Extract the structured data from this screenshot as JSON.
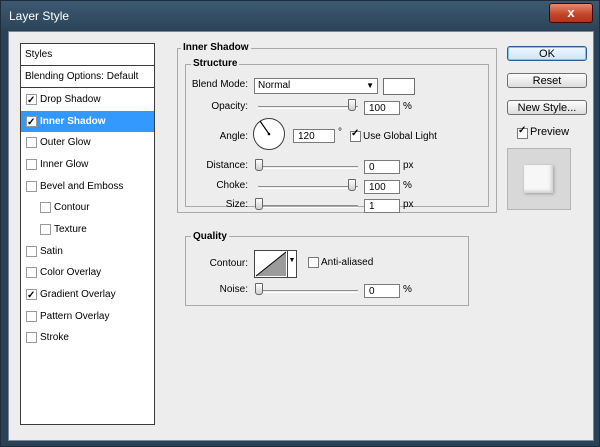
{
  "window": {
    "title": "Layer Style",
    "close": "x"
  },
  "list": {
    "header": "Styles",
    "items": [
      {
        "label": "Blending Options: Default",
        "checkbox": false
      },
      {
        "label": "Drop Shadow",
        "checkbox": true,
        "checked": true
      },
      {
        "label": "Inner Shadow",
        "checkbox": true,
        "checked": true,
        "selected": true
      },
      {
        "label": "Outer Glow",
        "checkbox": true,
        "checked": false
      },
      {
        "label": "Inner Glow",
        "checkbox": true,
        "checked": false
      },
      {
        "label": "Bevel and Emboss",
        "checkbox": true,
        "checked": false
      },
      {
        "label": "Contour",
        "checkbox": true,
        "checked": false
      },
      {
        "label": "Texture",
        "checkbox": true,
        "checked": false
      },
      {
        "label": "Satin",
        "checkbox": true,
        "checked": false
      },
      {
        "label": "Color Overlay",
        "checkbox": true,
        "checked": false
      },
      {
        "label": "Gradient Overlay",
        "checkbox": true,
        "checked": true
      },
      {
        "label": "Pattern Overlay",
        "checkbox": true,
        "checked": false
      },
      {
        "label": "Stroke",
        "checkbox": true,
        "checked": false
      }
    ]
  },
  "panel": {
    "title": "Inner Shadow",
    "structure": {
      "title": "Structure",
      "blend_mode_label": "Blend Mode:",
      "blend_mode_value": "Normal",
      "opacity_label": "Opacity:",
      "opacity_value": "100",
      "opacity_unit": "%",
      "opacity_level": 1.0,
      "angle_label": "Angle:",
      "angle_value": "120",
      "angle_unit": "°",
      "use_global_light": "Use Global Light",
      "distance_label": "Distance:",
      "distance_value": "0",
      "distance_unit": "px",
      "distance_level": 0.0,
      "choke_label": "Choke:",
      "choke_value": "100",
      "choke_unit": "%",
      "choke_level": 1.0,
      "size_label": "Size:",
      "size_value": "1",
      "size_unit": "px",
      "size_level": 0.0
    },
    "quality": {
      "title": "Quality",
      "contour_label": "Contour:",
      "anti_aliased": "Anti-aliased",
      "noise_label": "Noise:",
      "noise_value": "0",
      "noise_unit": "%",
      "noise_level": 0.0
    }
  },
  "buttons": {
    "ok": "OK",
    "reset": "Reset",
    "new_style": "New Style...",
    "preview": "Preview"
  }
}
